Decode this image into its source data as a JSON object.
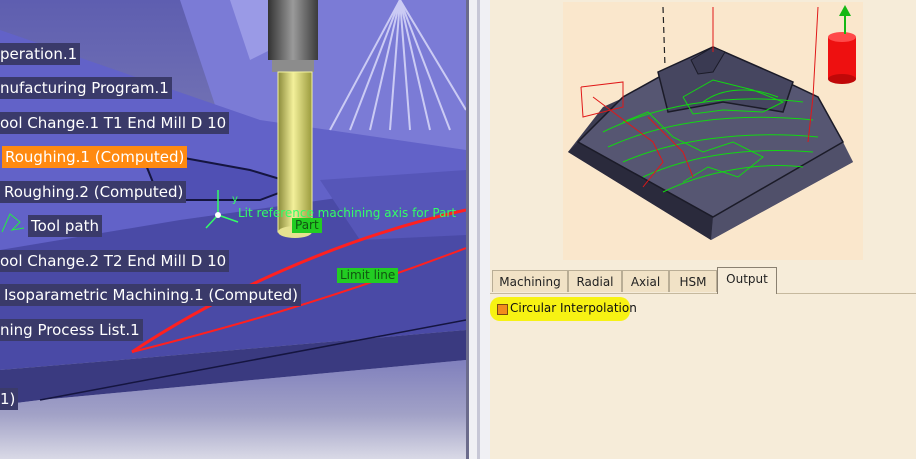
{
  "tree": {
    "items": [
      {
        "label": "peration.1"
      },
      {
        "label": "nufacturing Program.1"
      },
      {
        "label": "ool Change.1  T1 End Mill D 10"
      },
      {
        "label": "Roughing.1 (Computed)"
      },
      {
        "label": "Roughing.2 (Computed)"
      },
      {
        "label": "Tool path"
      },
      {
        "label": "ool Change.2  T2 End Mill D 10"
      },
      {
        "label": "Isoparametric Machining.1 (Computed)"
      },
      {
        "label": "ning Process List.1"
      },
      {
        "label": "1)"
      }
    ]
  },
  "viewport": {
    "part_label": "Part",
    "limit_line_label": "Limit line",
    "axis_label": "Lit reference machining axis for Part",
    "axis_x": "x",
    "axis_y": "y",
    "axis_z": "z"
  },
  "tabs": [
    {
      "label": "Machining"
    },
    {
      "label": "Radial"
    },
    {
      "label": "Axial"
    },
    {
      "label": "HSM"
    },
    {
      "label": "Output"
    }
  ],
  "active_tab": "Output",
  "options": {
    "circular_interpolation_label": "Circular Interpolation",
    "circular_interpolation_checked": true
  },
  "colors": {
    "selected_highlight": "#ff8a10",
    "tree_background": "#3a3a6a",
    "label_green": "#22cc22",
    "yellow_highlight": "#f7f213",
    "panel_background": "#f6ecd9"
  }
}
